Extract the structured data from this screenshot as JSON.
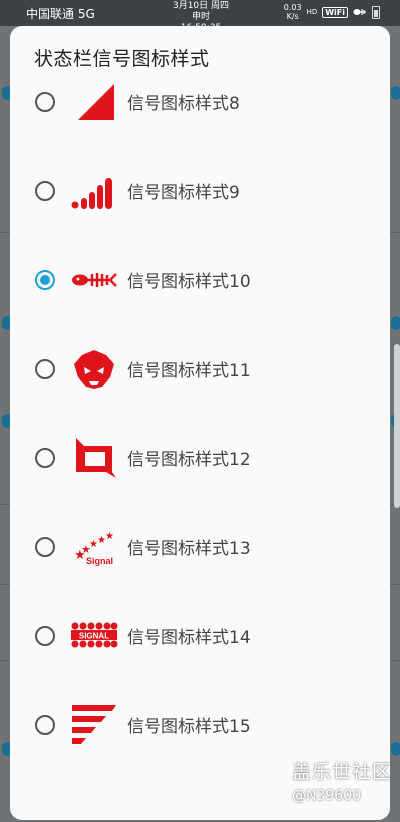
{
  "status_bar": {
    "carrier": "中国联通 5G",
    "date": "3月10日 周四",
    "time": "申时 16:59:35",
    "speed_value": "0.03",
    "speed_unit": "K/s",
    "hd": "HD",
    "wifi": "WiFi"
  },
  "dialog": {
    "title": "状态栏信号图标样式",
    "selected_index": 2,
    "options": [
      {
        "label": "信号图标样式8",
        "icon": "triangle-signal-icon",
        "checked": false
      },
      {
        "label": "信号图标样式9",
        "icon": "bars-signal-icon",
        "checked": false
      },
      {
        "label": "信号图标样式10",
        "icon": "fishbone-signal-icon",
        "checked": true
      },
      {
        "label": "信号图标样式11",
        "icon": "skull-signal-icon",
        "checked": false
      },
      {
        "label": "信号图标样式12",
        "icon": "square-frame-signal-icon",
        "checked": false
      },
      {
        "label": "信号图标样式13",
        "icon": "stars-signal-icon",
        "checked": false,
        "icon_text": "Signal"
      },
      {
        "label": "信号图标样式14",
        "icon": "dots-signal-icon",
        "checked": false,
        "icon_text": "SIGNAL"
      },
      {
        "label": "信号图标样式15",
        "icon": "stripes-signal-icon",
        "checked": false
      }
    ]
  },
  "watermark": {
    "site": "盖乐世社区",
    "user": "@N39600"
  },
  "colors": {
    "accent": "#1e9fd8",
    "icon_red": "#e0141b"
  }
}
